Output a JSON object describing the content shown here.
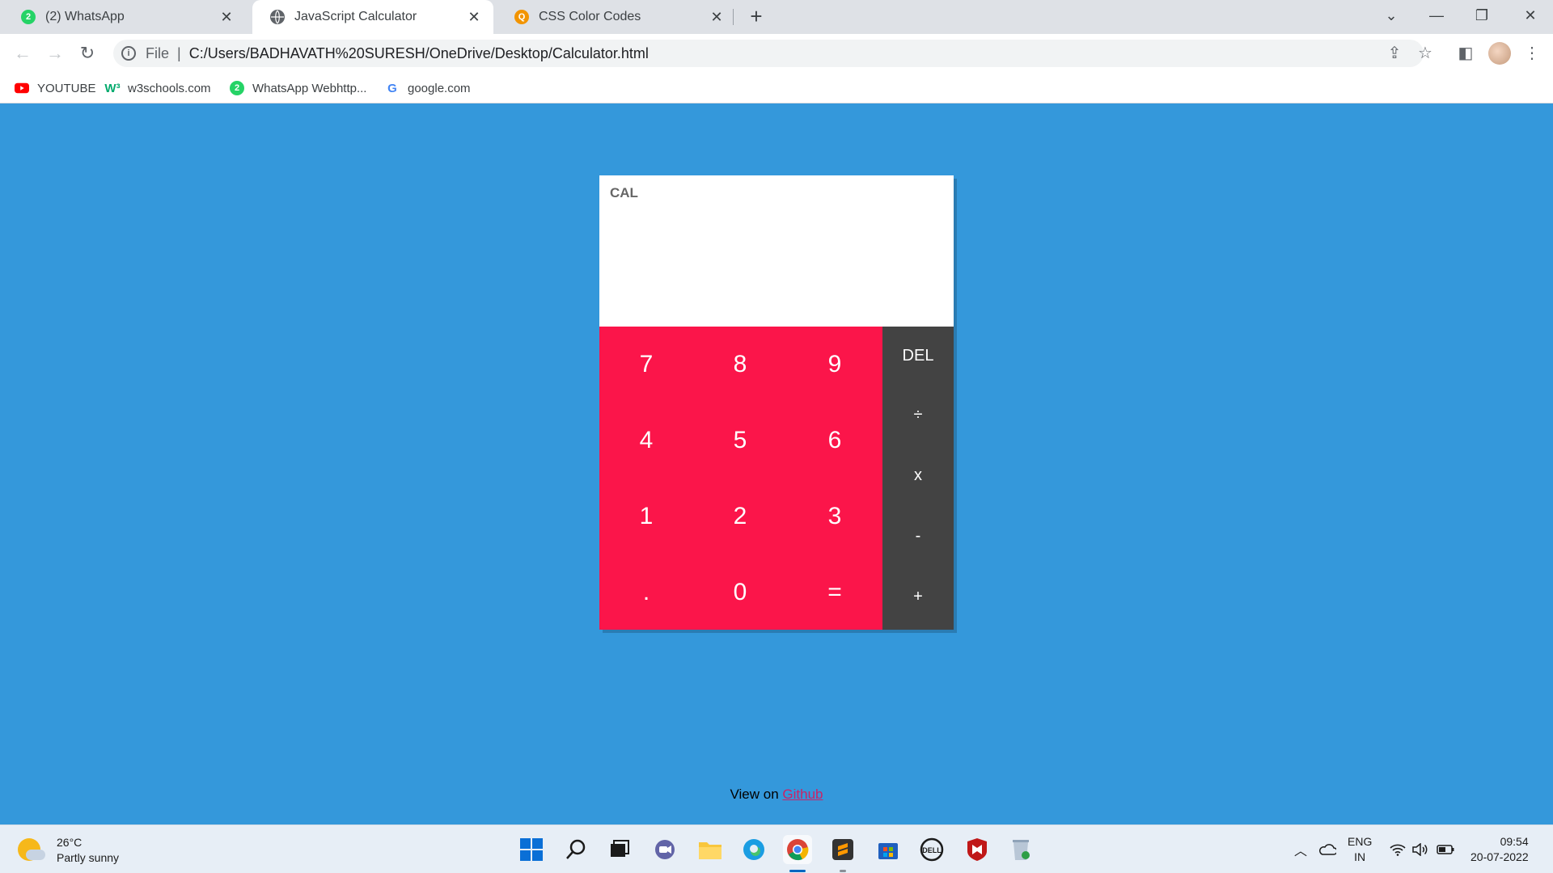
{
  "browser": {
    "tabs": [
      {
        "title": "(2) WhatsApp",
        "favicon": "whatsapp-icon",
        "badge": "2",
        "active": false
      },
      {
        "title": "JavaScript Calculator",
        "favicon": "globe-icon",
        "active": true
      },
      {
        "title": "CSS Color Codes",
        "favicon": "search-orange-icon",
        "active": false
      }
    ],
    "address": {
      "scheme": "File",
      "url": "C:/Users/BADHAVATH%20SURESH/OneDrive/Desktop/Calculator.html"
    },
    "bookmarks": [
      {
        "label": "YOUTUBE",
        "icon": "youtube-icon"
      },
      {
        "label": "w3schools.com",
        "icon": "w3schools-icon"
      },
      {
        "label": "WhatsApp Webhttp...",
        "icon": "whatsapp-icon",
        "badge": "2"
      },
      {
        "label": "google.com",
        "icon": "google-icon"
      }
    ]
  },
  "calculator": {
    "screen_label": "CAL",
    "keys": [
      "7",
      "8",
      "9",
      "4",
      "5",
      "6",
      "1",
      "2",
      "3",
      ".",
      "0",
      "="
    ],
    "operators": [
      "DEL",
      "÷",
      "x",
      "-",
      "+"
    ]
  },
  "footer": {
    "prefix": "View on",
    "link": "Github"
  },
  "taskbar": {
    "weather": {
      "temp": "26°C",
      "condition": "Partly sunny"
    },
    "language": {
      "code": "ENG",
      "region": "IN"
    },
    "clock": {
      "time": "09:54",
      "date": "20-07-2022"
    }
  },
  "colors": {
    "page_bg": "#3498db",
    "numpad": "#fb154a",
    "operators": "#434343",
    "link": "#cc2266"
  }
}
